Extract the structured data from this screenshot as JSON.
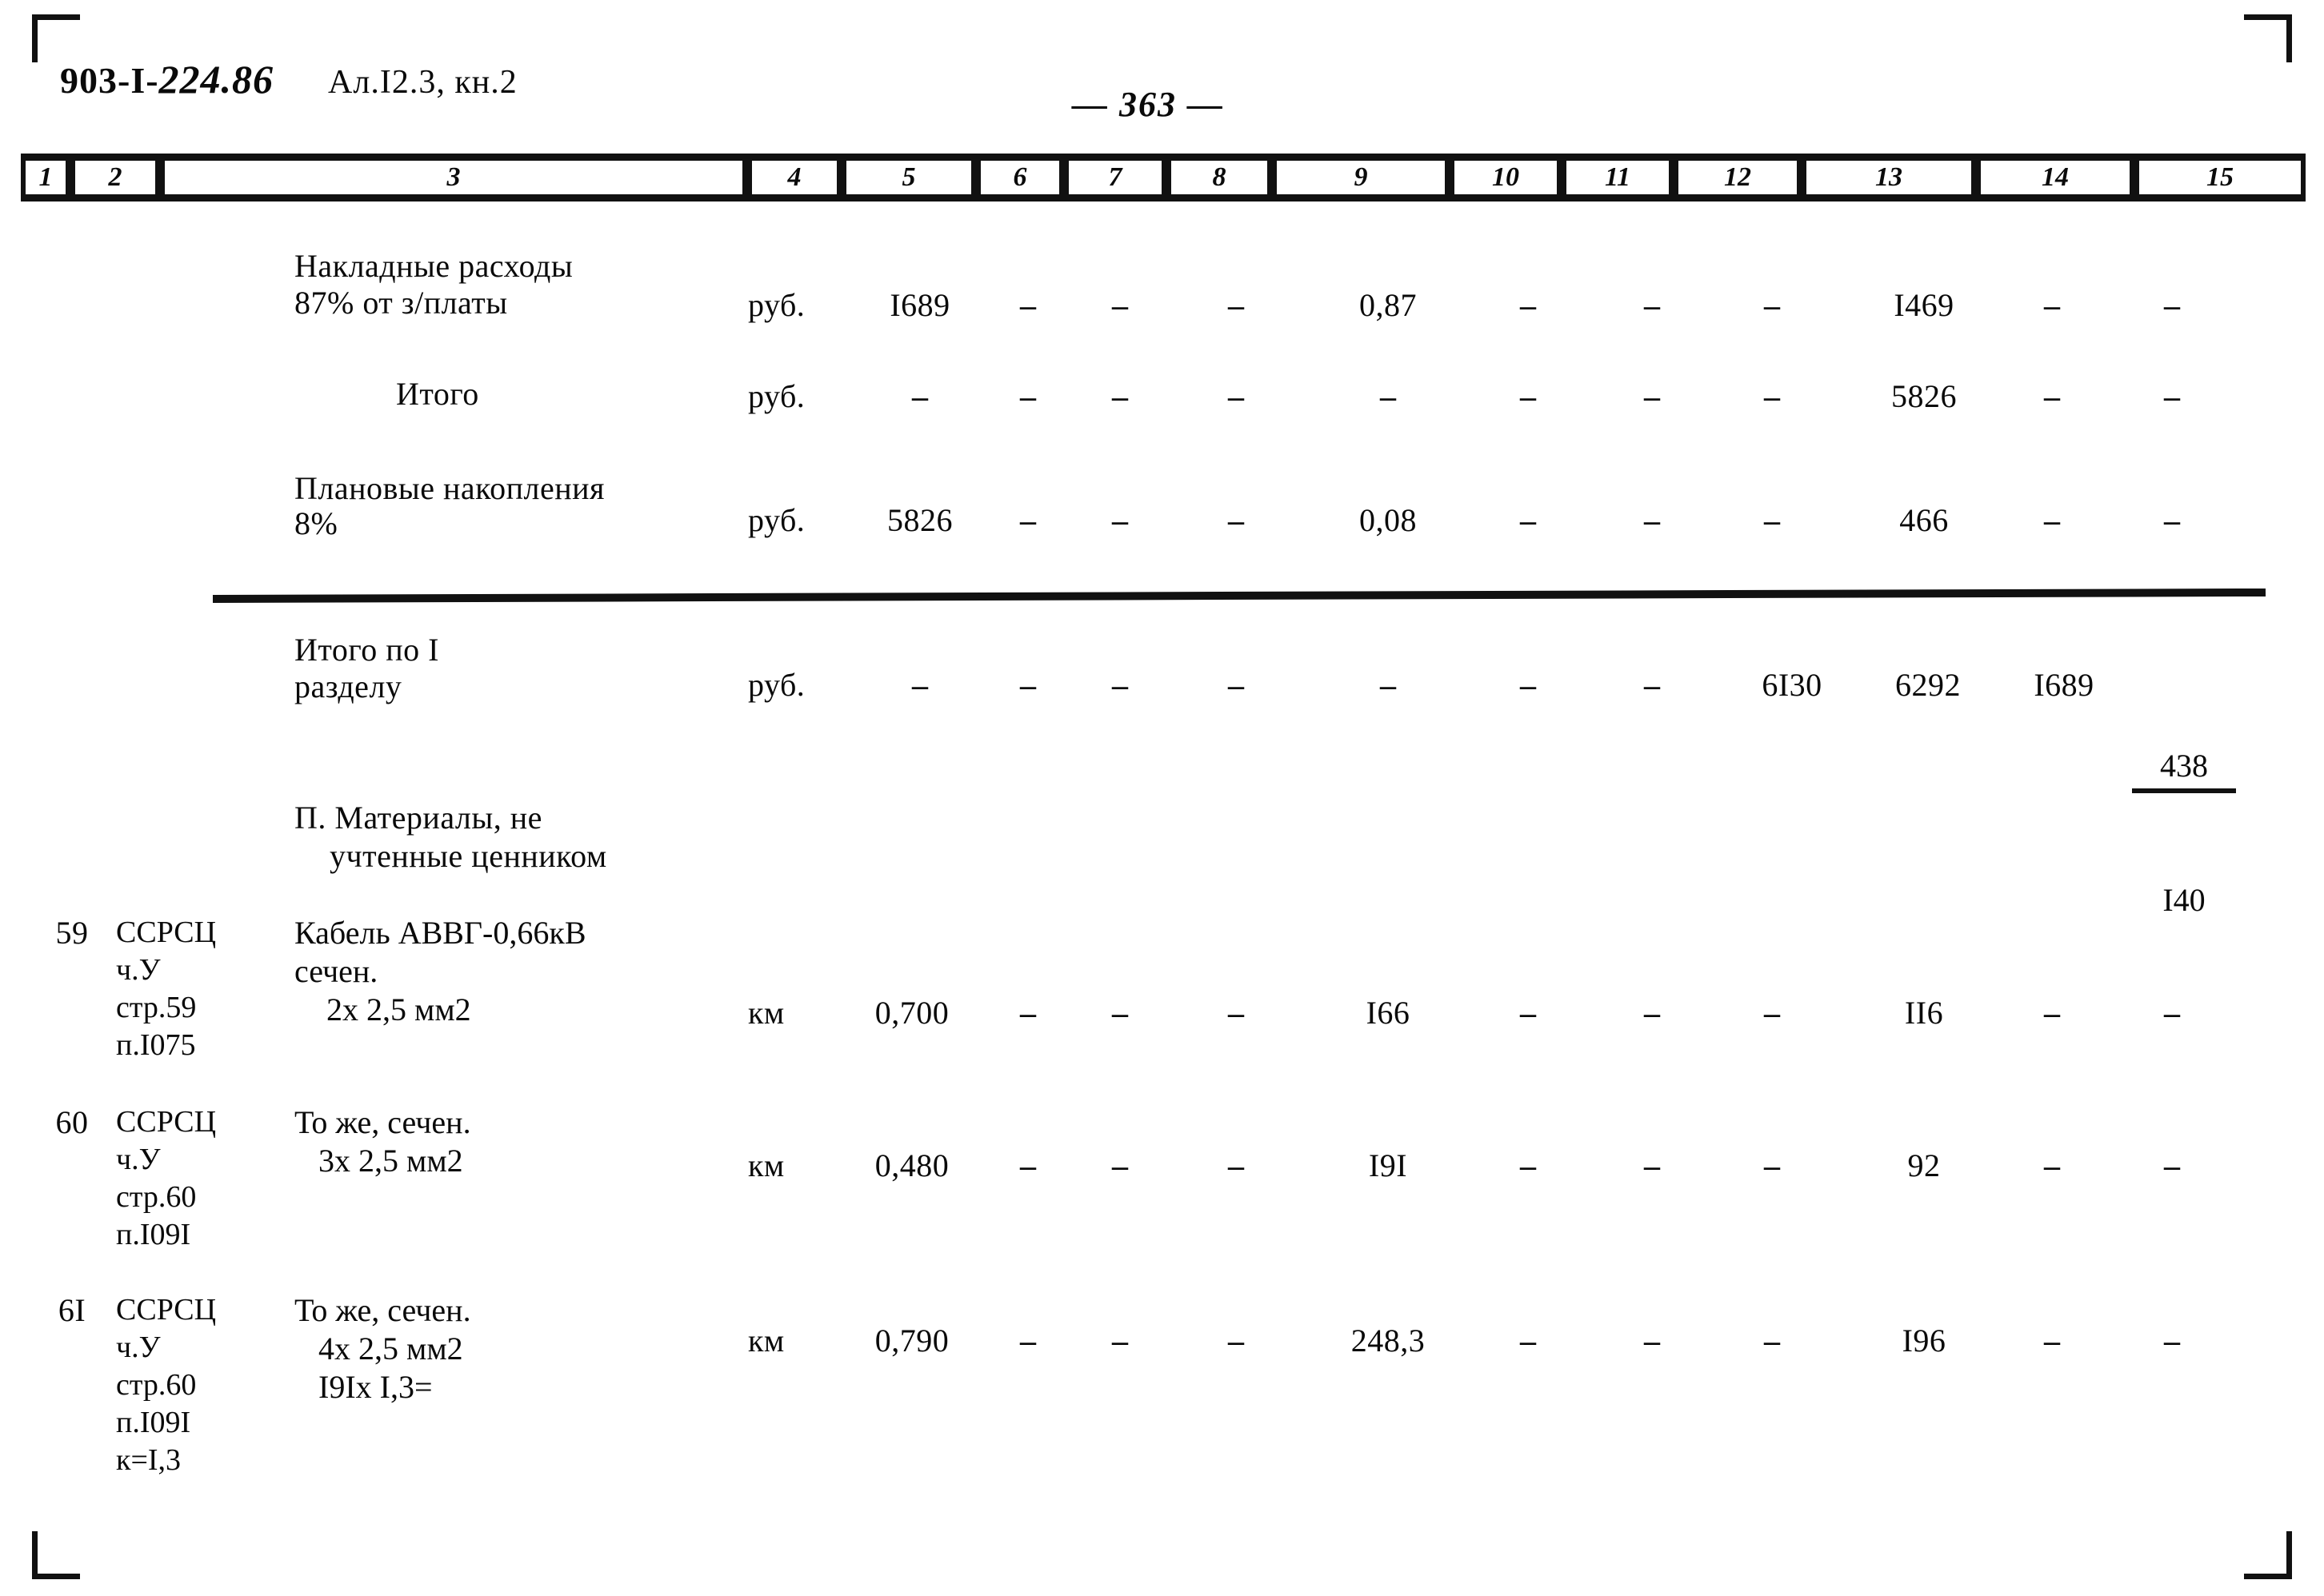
{
  "document": {
    "code_prefix": "903-I-",
    "code_suffix": "224.86",
    "album": "Ал.I2.3, кн.2",
    "page_number": "— 363 —"
  },
  "table": {
    "column_headers": [
      "1",
      "2",
      "3",
      "4",
      "5",
      "6",
      "7",
      "8",
      "9",
      "10",
      "11",
      "12",
      "13",
      "14",
      "15"
    ],
    "rows": [
      {
        "id": "overhead",
        "ref": "",
        "desc_line1": "Накладные расходы",
        "desc_line2": "87% от з/платы",
        "c4": "руб.",
        "c5": "I689",
        "c6": "–",
        "c7": "–",
        "c8": "–",
        "c9": "0,87",
        "c10": "–",
        "c11": "–",
        "c12": "–",
        "c13": "I469",
        "c14": "–",
        "c15": "–"
      },
      {
        "id": "subtotal",
        "ref": "",
        "desc_line1": "Итого",
        "desc_line2": "",
        "c4": "руб.",
        "c5": "–",
        "c6": "–",
        "c7": "–",
        "c8": "–",
        "c9": "–",
        "c10": "–",
        "c11": "–",
        "c12": "–",
        "c13": "5826",
        "c14": "–",
        "c15": "–"
      },
      {
        "id": "planned-savings",
        "ref": "",
        "desc_line1": "Плановые накопления",
        "desc_line2": "8%",
        "c4": "руб.",
        "c5": "5826",
        "c6": "–",
        "c7": "–",
        "c8": "–",
        "c9": "0,08",
        "c10": "–",
        "c11": "–",
        "c12": "–",
        "c13": "466",
        "c14": "–",
        "c15": "–"
      },
      {
        "id": "section-total",
        "ref": "",
        "desc_line1": "Итого по I",
        "desc_line2": "разделу",
        "c4": "руб.",
        "c5": "–",
        "c6": "–",
        "c7": "–",
        "c8": "–",
        "c9": "–",
        "c10": "–",
        "c11": "–",
        "c12": "6I30",
        "c13": "6292",
        "c14": "I689",
        "c15_top": "438",
        "c15_bottom": "I40"
      }
    ],
    "section_heading": {
      "line1": "П. Материалы, не",
      "line2": "учтенные ценником"
    },
    "material_rows": [
      {
        "no": "59",
        "ref_line1": "ССРСЦ",
        "ref_line2": "ч.У",
        "ref_line3": "стр.59",
        "ref_line4": "п.I075",
        "ref_line5": "",
        "desc_line1": "Кабель АВВГ-0,66кВ",
        "desc_line2": "сечен.",
        "desc_line3": "    2х 2,5 мм2",
        "desc_line4": "",
        "c4": "км",
        "c5": "0,700",
        "c6": "–",
        "c7": "–",
        "c8": "–",
        "c9": "I66",
        "c10": "–",
        "c11": "–",
        "c12": "–",
        "c13": "II6",
        "c14": "–",
        "c15": "–"
      },
      {
        "no": "60",
        "ref_line1": "ССРСЦ",
        "ref_line2": "ч.У",
        "ref_line3": "стр.60",
        "ref_line4": "п.I09I",
        "ref_line5": "",
        "desc_line1": "То же, сечен.",
        "desc_line2": "   3х 2,5 мм2",
        "desc_line3": "",
        "desc_line4": "",
        "c4": "км",
        "c5": "0,480",
        "c6": "–",
        "c7": "–",
        "c8": "–",
        "c9": "I9I",
        "c10": "–",
        "c11": "–",
        "c12": "–",
        "c13": "92",
        "c14": "–",
        "c15": "–"
      },
      {
        "no": "6I",
        "ref_line1": "ССРСЦ",
        "ref_line2": "ч.У",
        "ref_line3": "стр.60",
        "ref_line4": "п.I09I",
        "ref_line5": "к=I,3",
        "desc_line1": "То же, сечен.",
        "desc_line2": "   4х 2,5 мм2",
        "desc_line3": "   I9Iх I,3=",
        "desc_line4": "",
        "c4": "км",
        "c5": "0,790",
        "c6": "–",
        "c7": "–",
        "c8": "–",
        "c9": "248,3",
        "c10": "–",
        "c11": "–",
        "c12": "–",
        "c13": "I96",
        "c14": "–",
        "c15": "–"
      }
    ]
  }
}
